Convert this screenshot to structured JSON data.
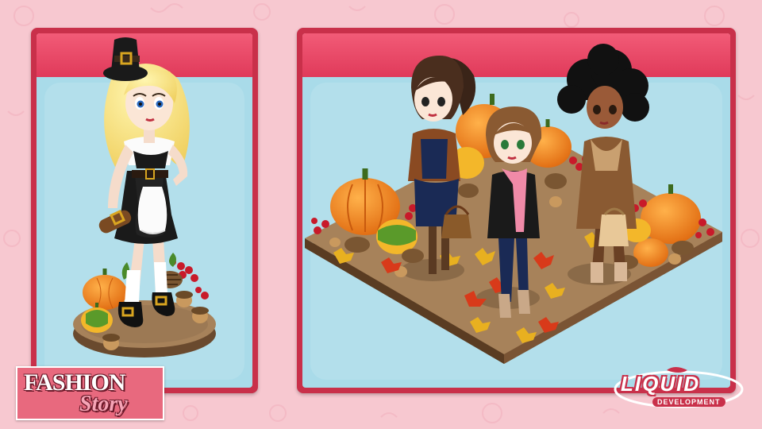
{
  "logos": {
    "fashion_word": "FASHION",
    "story_word": "Story",
    "developer_word": "LIQUID",
    "developer_sub": "DEVELOPMENT"
  },
  "colors": {
    "background": "#f7c8d0",
    "panel_frame": "#c9304a",
    "panel_header": "#f25b77",
    "panel_body": "#a9dbe9",
    "platform": "#8a6a4a",
    "pumpkin": "#f08a1f"
  },
  "panels": [
    {
      "id": "single-avatar",
      "characters": 1
    },
    {
      "id": "group-showcase",
      "characters": 3
    }
  ]
}
